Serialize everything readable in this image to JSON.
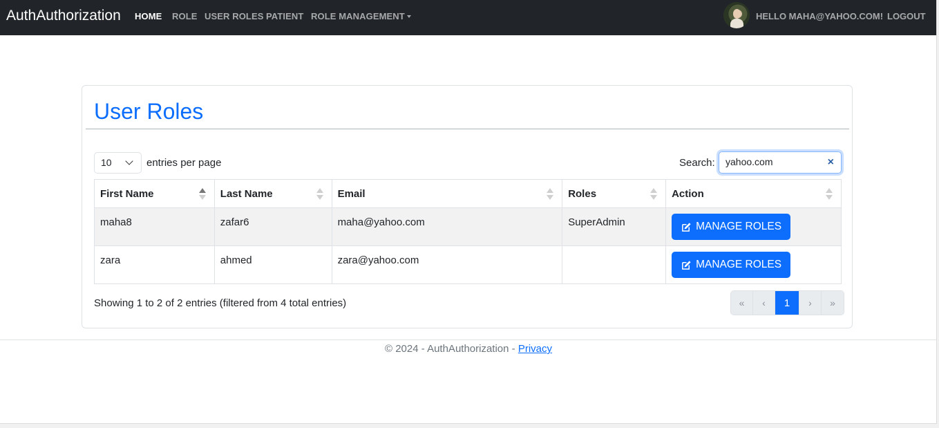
{
  "navbar": {
    "brand": "AuthAuthorization",
    "links": [
      "HOME",
      "ROLE",
      "USER ROLES",
      "PATIENT",
      "ROLE MANAGEMENT"
    ],
    "greeting": "HELLO MAHA@YAHOO.COM!",
    "logout": "LOGOUT"
  },
  "page": {
    "title": "User Roles",
    "length_value": "10",
    "length_label": "entries per page",
    "search_label": "Search:",
    "search_value": "yahoo.com",
    "clear_symbol": "×"
  },
  "table": {
    "columns": [
      "First Name",
      "Last Name",
      "Email",
      "Roles",
      "Action"
    ],
    "rows": [
      {
        "first_name": "maha8",
        "last_name": "zafar6",
        "email": "maha@yahoo.com",
        "roles": "SuperAdmin",
        "action": "MANAGE ROLES"
      },
      {
        "first_name": "zara",
        "last_name": "ahmed",
        "email": "zara@yahoo.com",
        "roles": "",
        "action": "MANAGE ROLES"
      }
    ]
  },
  "info": "Showing 1 to 2 of 2 entries (filtered from 4 total entries)",
  "pagination": {
    "first": "«",
    "prev": "‹",
    "current": "1",
    "next": "›",
    "last": "»"
  },
  "footer": {
    "text": "© 2024 - AuthAuthorization - ",
    "privacy": "Privacy"
  },
  "colors": {
    "navbar_bg": "#212529",
    "primary": "#0d6efd"
  },
  "icons": {
    "edit": "pencil-square-icon",
    "sort": "sort-arrows-icon",
    "clear": "close-icon",
    "dropdown": "chevron-down-icon"
  }
}
